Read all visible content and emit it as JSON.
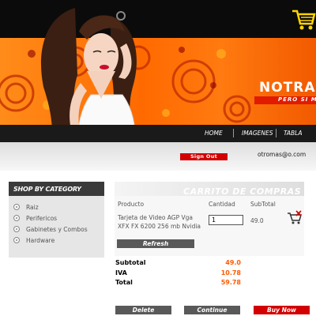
{
  "brand": {
    "name": "NOTRAN",
    "tagline": "PERO SI M"
  },
  "nav": {
    "items": [
      "HOME",
      "IMAGENES",
      "TABLA"
    ]
  },
  "user": {
    "signout_label": "Sign Out",
    "email": "otromas@o.com"
  },
  "categories": {
    "title": "SHOP BY CATEGORY",
    "items": [
      "Raiz",
      "Perifericos",
      "Gabinetes y Combos",
      "Hardware"
    ]
  },
  "cart": {
    "title": "CARRITO DE COMPRAS",
    "headers": {
      "product": "Producto",
      "quantity": "Cantidad",
      "subtotal": "SubTotal"
    },
    "items": [
      {
        "product": "Tarjeta de Video AGP Vga XFX FX 6200 256 mb Nvidia",
        "quantity": "1",
        "subtotal": "49.0"
      }
    ],
    "refresh_label": "Refresh",
    "summary": [
      {
        "label": "Subtotal",
        "value": "49.0"
      },
      {
        "label": "IVA",
        "value": "10.78"
      },
      {
        "label": "Total",
        "value": "59.78"
      }
    ],
    "actions": {
      "delete": "Delete",
      "continue": "Continue",
      "buy": "Buy Now"
    }
  },
  "colors": {
    "accent_red": "#d20000",
    "orange": "#ff5a00",
    "dark": "#1a1a1a"
  }
}
